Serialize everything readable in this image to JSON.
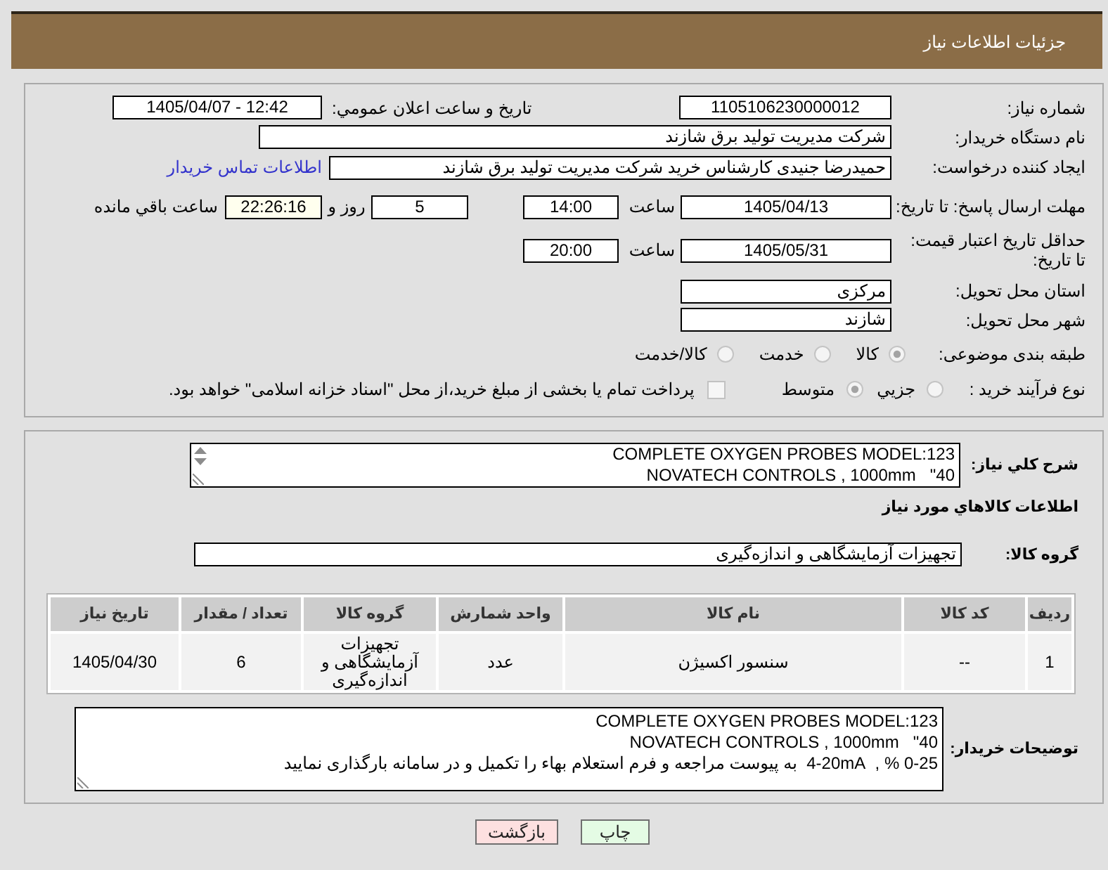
{
  "header": {
    "title": "جزئیات اطلاعات نیاز"
  },
  "summary": {
    "need_number": {
      "label": "شماره نیاز:",
      "value": "1105106230000012"
    },
    "announcement": {
      "label": "تاریخ و ساعت اعلان عمومي:",
      "value": "1405/04/07 - 12:42"
    },
    "buyer_org": {
      "label": "نام دستگاه خریدار:",
      "value": "شرکت مدیریت تولید برق شازند"
    },
    "requester": {
      "label": "ایجاد کننده درخواست:",
      "value": "حمیدرضا جنیدی کارشناس خرید شرکت مدیریت تولید برق شازند",
      "link": "اطلاعات تماس خریدار"
    },
    "reply_deadline": {
      "label": "مهلت ارسال پاسخ: تا تاریخ:",
      "date": "1405/04/13",
      "time_label": "ساعت",
      "time": "14:00",
      "days": "5",
      "days_label": "روز و",
      "remaining": "22:26:16",
      "remaining_label": "ساعت باقي مانده"
    },
    "price_validity": {
      "label": "حداقل تاریخ اعتبار قیمت: تا تاریخ:",
      "date": "1405/05/31",
      "time_label": "ساعت",
      "time": "20:00"
    },
    "province": {
      "label": "استان محل تحویل:",
      "value": "مرکزی"
    },
    "city": {
      "label": "شهر محل تحویل:",
      "value": "شازند"
    },
    "category": {
      "label": "طبقه بندی موضوعی:",
      "options": [
        {
          "label": "کالا",
          "selected": true
        },
        {
          "label": "خدمت",
          "selected": false
        },
        {
          "label": "کالا/خدمت",
          "selected": false
        }
      ]
    },
    "process": {
      "label": "نوع فرآیند خرید :",
      "options": [
        {
          "label": "جزيي",
          "selected": false
        },
        {
          "label": "متوسط",
          "selected": true
        }
      ],
      "treasury_payment": {
        "label": "پرداخت تمام یا بخشی از مبلغ خرید،از محل \"اسناد خزانه اسلامی\" خواهد بود.",
        "checked": false
      }
    }
  },
  "items": {
    "description": {
      "label": "شرح کلي نیاز:",
      "lines": [
        "COMPLETE OXYGEN PROBES MODEL:123",
        "40\"   NOVATECH CONTROLS , 1000mm"
      ]
    },
    "section_title": "اطلاعات کالاهاي مورد نیاز",
    "group": {
      "label": "گروه کالا:",
      "value": "تجهیزات آزمایشگاهی و اندازه‌گیری"
    },
    "table": {
      "columns": [
        "ردیف",
        "کد کالا",
        "نام کالا",
        "واحد شمارش",
        "گروه کالا",
        "تعداد / مقدار",
        "تاریخ نیاز"
      ],
      "rows": [
        [
          "1",
          "--",
          "سنسور اکسیژن",
          "عدد",
          "تجهیزات آزمایشگاهی و اندازه‌گیری",
          "6",
          "1405/04/30"
        ]
      ]
    },
    "buyer_notes": {
      "label": "توضیحات خریدار:",
      "lines": [
        "COMPLETE OXYGEN PROBES MODEL:123",
        "40\"   NOVATECH CONTROLS , 1000mm",
        "0-25 % ,  4-20mA  به پیوست مراجعه و فرم استعلام بهاء را تکمیل و در سامانه بارگذاری نمایید"
      ]
    }
  },
  "buttons": [
    {
      "label": "چاپ",
      "kind": "print"
    },
    {
      "label": "بازگشت",
      "kind": "back"
    }
  ]
}
